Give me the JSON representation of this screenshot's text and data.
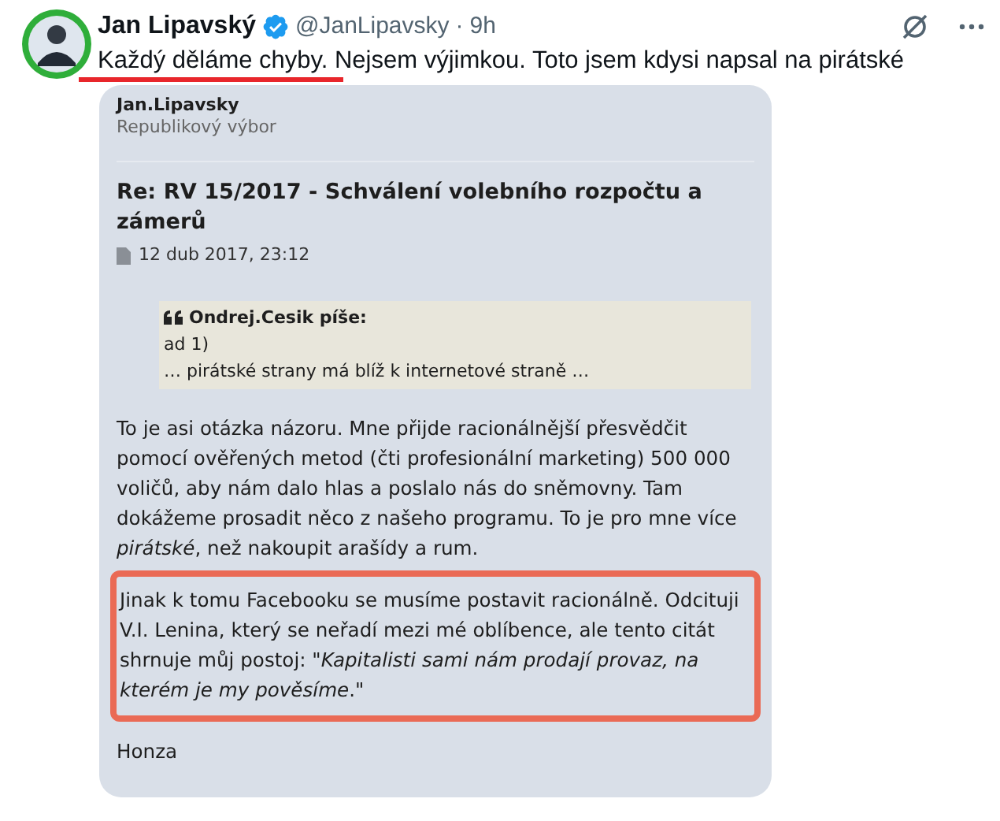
{
  "tweet": {
    "name": "Jan Lipavský",
    "handle": "@JanLipavsky",
    "separator": "·",
    "time": "9h",
    "verified": true,
    "text": "Každý děláme chyby. Nejsem výjimkou. Toto jsem kdysi napsal na pirátské"
  },
  "embedded_post": {
    "author": "Jan.Lipavsky",
    "role": "Republikový výbor",
    "title": "Re: RV 15/2017 - Schválení volebního rozpočtu a zámerů",
    "date": "12 dub 2017, 23:12",
    "quote": {
      "header": "Ondrej.Cesik píše:",
      "lines": [
        "ad 1)",
        "… pirátské strany má blíž k internetové straně …"
      ]
    },
    "paragraphs": [
      {
        "text": "To je asi otázka názoru. Mne přijde racionálnější přesvědčit pomocí ověřených metod (čti profesionální marketing) 500 000 voličů, aby nám dalo hlas a poslalo nás do sněmovny. Tam dokážeme prosadit něco z našeho programu. To je pro mne více *pirátské*, než nakoupit arašídy a rum.",
        "highlighted": false
      },
      {
        "text": "Jinak k tomu Facebooku se musíme postavit racionálně. Odcituji V.I. Lenina, který se neřadí mezi mé oblíbence, ale tento citát shrnuje můj postoj: \"*Kapitalisti sami nám prodají provaz, na kterém je my pověsíme*.\"",
        "highlighted": true
      }
    ],
    "signature": "Honza"
  }
}
